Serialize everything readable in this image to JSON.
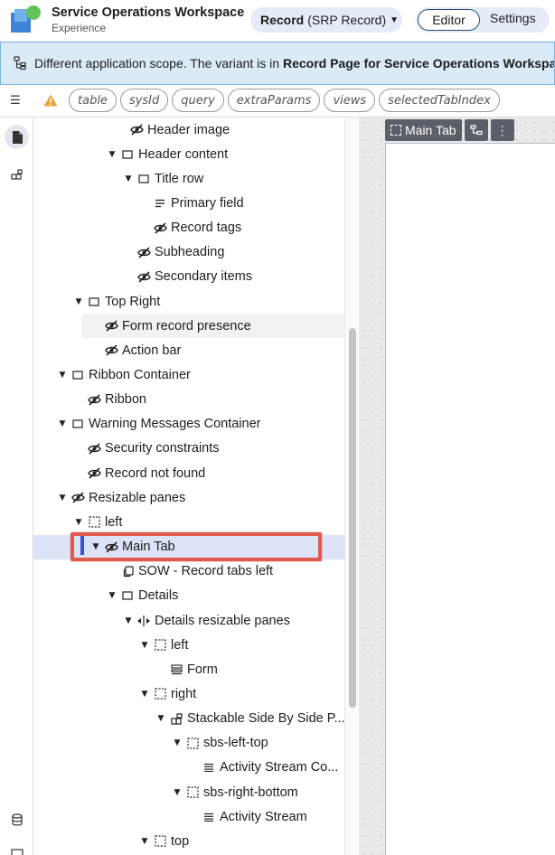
{
  "header": {
    "app_title": "Service Operations Workspace",
    "app_subtitle": "Experience",
    "record_label_bold": "Record",
    "record_label_rest": "(SRP Record)",
    "editor_label": "Editor",
    "settings_label": "Settings"
  },
  "banner": {
    "text_plain": "Different application scope. The variant is in ",
    "text_bold": "Record Page for Service Operations Workspace"
  },
  "toolbar": {
    "chips": [
      "table",
      "sysId",
      "query",
      "extraParams",
      "views",
      "selectedTabIndex"
    ]
  },
  "canvas": {
    "tab_label": "Main Tab"
  },
  "tree": {
    "rows": [
      {
        "label": "Header image",
        "twisty": "",
        "icon": "eye-slash-icon",
        "state": ""
      },
      {
        "label": "Header content",
        "twisty": "down",
        "icon": "container-icon",
        "state": ""
      },
      {
        "label": "Title row",
        "twisty": "down",
        "icon": "container-icon",
        "state": ""
      },
      {
        "label": "Primary field",
        "twisty": "",
        "icon": "text-lines-icon",
        "state": ""
      },
      {
        "label": "Record tags",
        "twisty": "",
        "icon": "eye-slash-icon",
        "state": ""
      },
      {
        "label": "Subheading",
        "twisty": "",
        "icon": "eye-slash-icon",
        "state": ""
      },
      {
        "label": "Secondary items",
        "twisty": "",
        "icon": "eye-slash-icon",
        "state": ""
      },
      {
        "label": "Top Right",
        "twisty": "down",
        "icon": "container-icon",
        "state": ""
      },
      {
        "label": "Form record presence",
        "twisty": "",
        "icon": "eye-slash-icon",
        "state": "hover"
      },
      {
        "label": "Action bar",
        "twisty": "",
        "icon": "eye-slash-icon",
        "state": ""
      },
      {
        "label": "Ribbon Container",
        "twisty": "down",
        "icon": "container-icon",
        "state": ""
      },
      {
        "label": "Ribbon",
        "twisty": "",
        "icon": "eye-slash-icon",
        "state": ""
      },
      {
        "label": "Warning Messages Container",
        "twisty": "down",
        "icon": "container-icon",
        "state": ""
      },
      {
        "label": "Security constraints",
        "twisty": "",
        "icon": "eye-slash-icon",
        "state": ""
      },
      {
        "label": "Record not found",
        "twisty": "",
        "icon": "eye-slash-icon",
        "state": ""
      },
      {
        "label": "Resizable panes",
        "twisty": "down",
        "icon": "eye-slash-icon",
        "state": ""
      },
      {
        "label": "left",
        "twisty": "down",
        "icon": "dashed-box-icon",
        "state": ""
      },
      {
        "label": "Main Tab",
        "twisty": "down",
        "icon": "eye-slash-icon",
        "state": "selected"
      },
      {
        "label": "SOW - Record tabs left",
        "twisty": "",
        "icon": "copy-icon",
        "state": ""
      },
      {
        "label": "Details",
        "twisty": "down",
        "icon": "container-icon",
        "state": ""
      },
      {
        "label": "Details resizable panes",
        "twisty": "down",
        "icon": "resize-icon",
        "state": ""
      },
      {
        "label": "left",
        "twisty": "down",
        "icon": "dashed-box-icon",
        "state": ""
      },
      {
        "label": "Form",
        "twisty": "",
        "icon": "form-icon",
        "state": ""
      },
      {
        "label": "right",
        "twisty": "down",
        "icon": "dashed-box-icon",
        "state": ""
      },
      {
        "label": "Stackable Side By Side P...",
        "twisty": "down",
        "icon": "stack-icon",
        "state": ""
      },
      {
        "label": "sbs-left-top",
        "twisty": "down",
        "icon": "dashed-box-icon",
        "state": ""
      },
      {
        "label": "Activity Stream Co...",
        "twisty": "",
        "icon": "list-icon",
        "state": ""
      },
      {
        "label": "sbs-right-bottom",
        "twisty": "down",
        "icon": "dashed-box-icon",
        "state": ""
      },
      {
        "label": "Activity Stream",
        "twisty": "",
        "icon": "list-icon",
        "state": ""
      },
      {
        "label": "top",
        "twisty": "down",
        "icon": "dashed-box-icon",
        "state": ""
      }
    ]
  }
}
